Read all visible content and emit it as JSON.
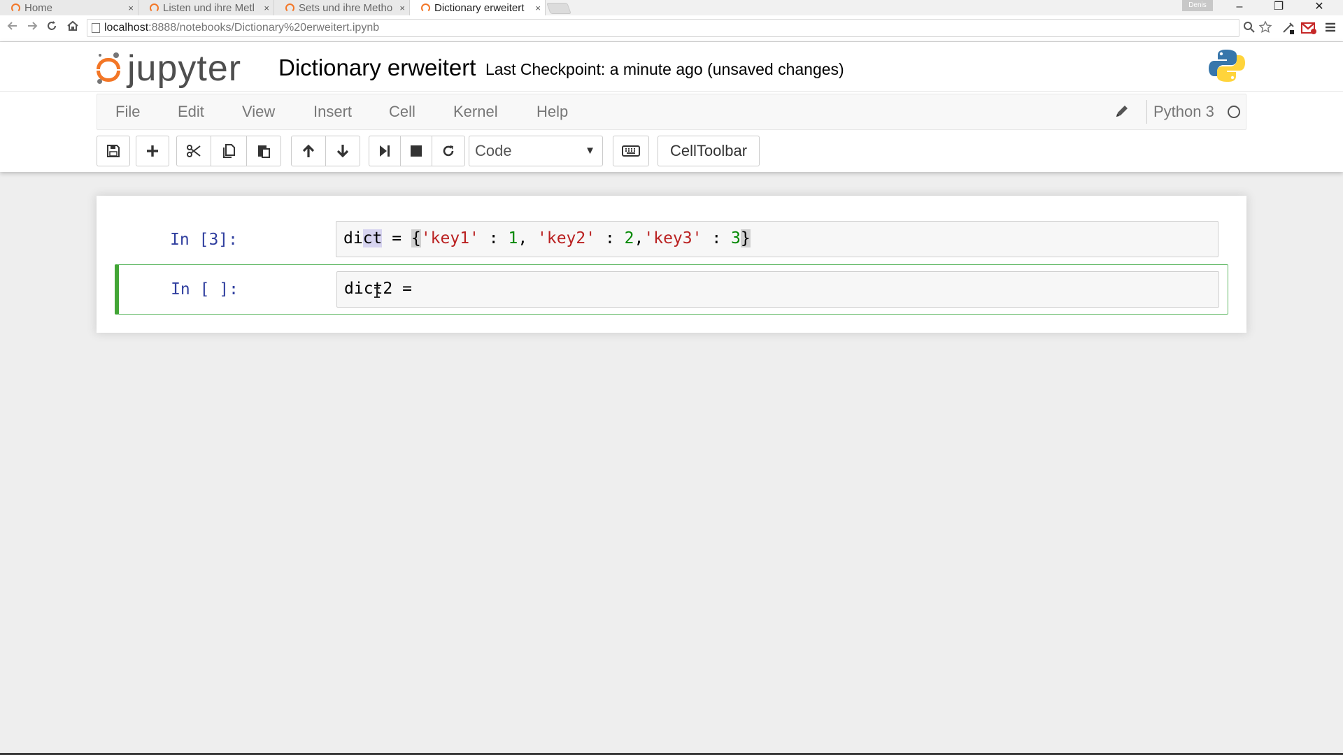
{
  "browser": {
    "tabs": [
      {
        "title": "Home",
        "active": false
      },
      {
        "title": "Listen und ihre Metl",
        "active": false
      },
      {
        "title": "Sets und ihre Metho",
        "active": false
      },
      {
        "title": "Dictionary erweitert",
        "active": true
      }
    ],
    "tab_close_glyph": "×",
    "profile_label": "Denis",
    "window_controls": {
      "minimize": "–",
      "restore": "❐",
      "close": "✕"
    },
    "url_host": "localhost",
    "url_path": ":8888/notebooks/Dictionary%20erweitert.ipynb",
    "icons": {
      "back": "back-arrow-icon",
      "forward": "forward-arrow-icon",
      "reload": "reload-icon",
      "home": "home-icon",
      "zoom": "zoom-icon",
      "bookmark": "star-icon",
      "extension": "extension-icon",
      "gmail": "gmail-icon",
      "menu": "hamburger-menu-icon"
    }
  },
  "jupyter": {
    "logo_text": "jupyter",
    "notebook_title": "Dictionary erweitert",
    "checkpoint_text": "Last Checkpoint: a minute ago (unsaved changes)",
    "menu": [
      "File",
      "Edit",
      "View",
      "Insert",
      "Cell",
      "Kernel",
      "Help"
    ],
    "kernel_name": "Python 3",
    "cell_type_select": "Code",
    "celltoolbar_label": "CellToolbar",
    "toolbar_icons": [
      "save-icon",
      "plus-icon",
      "cut-icon",
      "copy-icon",
      "paste-icon",
      "arrow-up-icon",
      "arrow-down-icon",
      "run-icon",
      "stop-icon",
      "restart-icon",
      "keyboard-icon"
    ],
    "colors": {
      "brand_orange": "#f37626",
      "prompt_blue": "#303f9f",
      "selected_cell_green": "#42a535",
      "string_red": "#ba2121",
      "number_green": "#008800"
    }
  },
  "cells": [
    {
      "prompt": "In [3]:",
      "code_parts": {
        "p1": "di",
        "p2": "ct",
        "p3": " = ",
        "p4": "{",
        "p5": "'key1'",
        "p6": " : ",
        "p7": "1",
        "p8": ", ",
        "p9": "'key2'",
        "p10": " : ",
        "p11": "2",
        "p12": ",",
        "p13": "'key3'",
        "p14": " : ",
        "p15": "3",
        "p16": "}"
      }
    },
    {
      "prompt": "In [ ]:",
      "code": "dict2 =",
      "selected": true
    }
  ]
}
